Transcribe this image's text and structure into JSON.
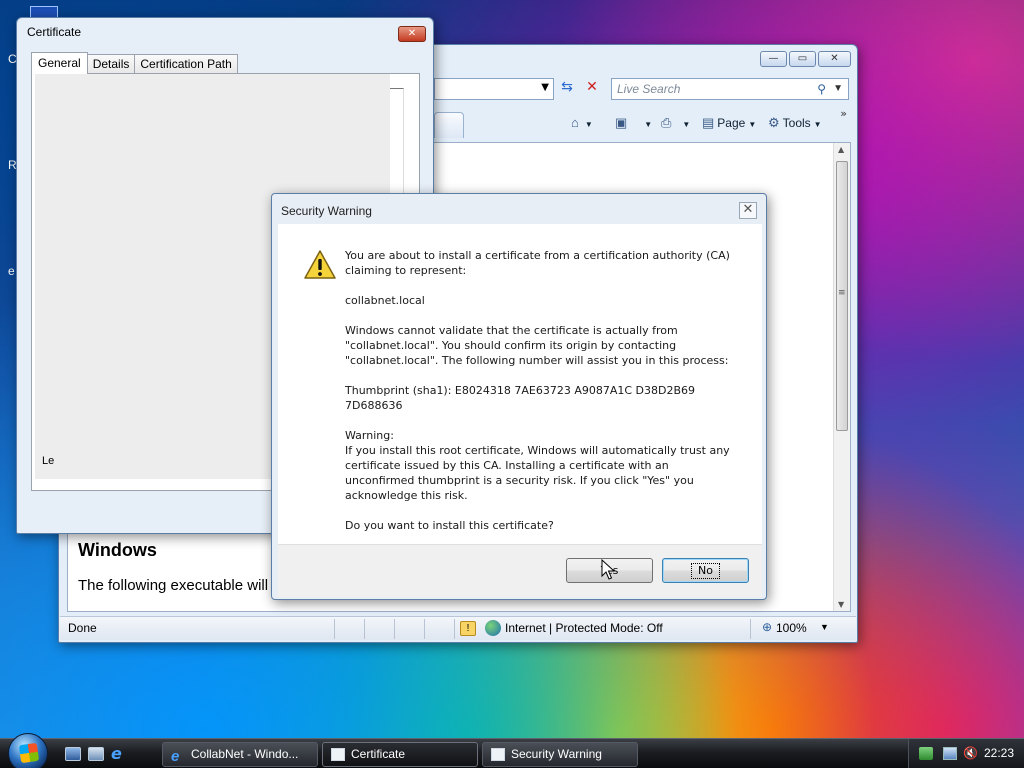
{
  "desktop": {
    "frag_c": "C",
    "frag_r": "R",
    "frag_e": "e"
  },
  "ie": {
    "search_placeholder": "Live Search",
    "page_label": "Page",
    "tools_label": "Tools",
    "content_heading": "Windows",
    "content_text": "The following executable will",
    "status_done": "Done",
    "status_zone": "Internet | Protected Mode: Off",
    "zoom": "100%"
  },
  "certificate": {
    "title": "Certificate",
    "tabs": [
      "General",
      "Details",
      "Certification Path"
    ],
    "active_tab": "General",
    "bottom_fragment": "Le"
  },
  "security_warning": {
    "title": "Security Warning",
    "line1": "You are about to install a certificate from a certification authority (CA) claiming to represent:",
    "host": "collabnet.local",
    "para2": "Windows cannot validate that the certificate is actually from \"collabnet.local\". You should confirm its origin by contacting \"collabnet.local\". The following number will assist you in this process:",
    "thumbprint": "Thumbprint (sha1): E8024318 7AE63723 A9087A1C D38D2B69 7D688636",
    "warning_label": "Warning:",
    "warning_text": "If you install this root certificate, Windows will automatically trust any certificate issued by this CA. Installing a certificate with an unconfirmed thumbprint is a security risk. If you click \"Yes\" you acknowledge this risk.",
    "question": "Do you want to install this certificate?",
    "yes_label": "Yes",
    "no_label": "No"
  },
  "taskbar": {
    "buttons": [
      {
        "label": "CollabNet - Windo...",
        "icon": "ie-icon"
      },
      {
        "label": "Certificate",
        "icon": "window-icon"
      },
      {
        "label": "Security Warning",
        "icon": "window-icon"
      }
    ],
    "clock": "22:23"
  },
  "colors": {
    "warning_yellow": "#f5d33a",
    "default_button_border": "#3c7fb1"
  }
}
